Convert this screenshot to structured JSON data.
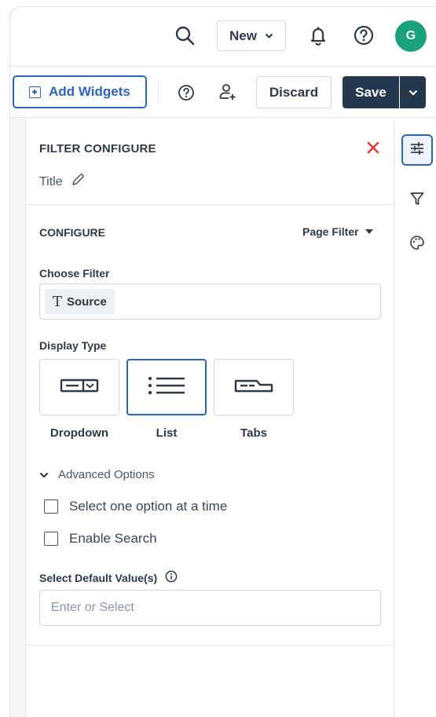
{
  "header": {
    "new_label": "New",
    "avatar_initial": "G"
  },
  "toolbar": {
    "add_widgets_label": "Add Widgets",
    "discard_label": "Discard",
    "save_label": "Save"
  },
  "panel": {
    "title": "FILTER CONFIGURE",
    "title_field_label": "Title",
    "configure_label": "CONFIGURE",
    "page_filter_label": "Page Filter",
    "choose_filter_label": "Choose Filter",
    "selected_filter": "Source",
    "display_type_label": "Display Type",
    "display_types": [
      {
        "label": "Dropdown",
        "selected": false
      },
      {
        "label": "List",
        "selected": true
      },
      {
        "label": "Tabs",
        "selected": false
      }
    ],
    "advanced_label": "Advanced Options",
    "options": [
      {
        "label": "Select one option at a time",
        "checked": false
      },
      {
        "label": "Enable Search",
        "checked": false
      }
    ],
    "default_value_label": "Select Default Value(s)",
    "default_value_placeholder": "Enter or Select"
  },
  "colors": {
    "accent": "#2b63c6",
    "save_button": "#24384f",
    "avatar": "#1aa37a",
    "close": "#e53935"
  },
  "icons": [
    "search-icon",
    "chevron-down-icon",
    "bell-icon",
    "help-icon",
    "plus-square-icon",
    "add-user-icon",
    "sliders-icon",
    "funnel-icon",
    "palette-icon",
    "close-icon",
    "pencil-icon",
    "caret-down-icon",
    "text-type-icon",
    "dropdown-type-icon",
    "list-type-icon",
    "tabs-type-icon",
    "info-icon"
  ]
}
